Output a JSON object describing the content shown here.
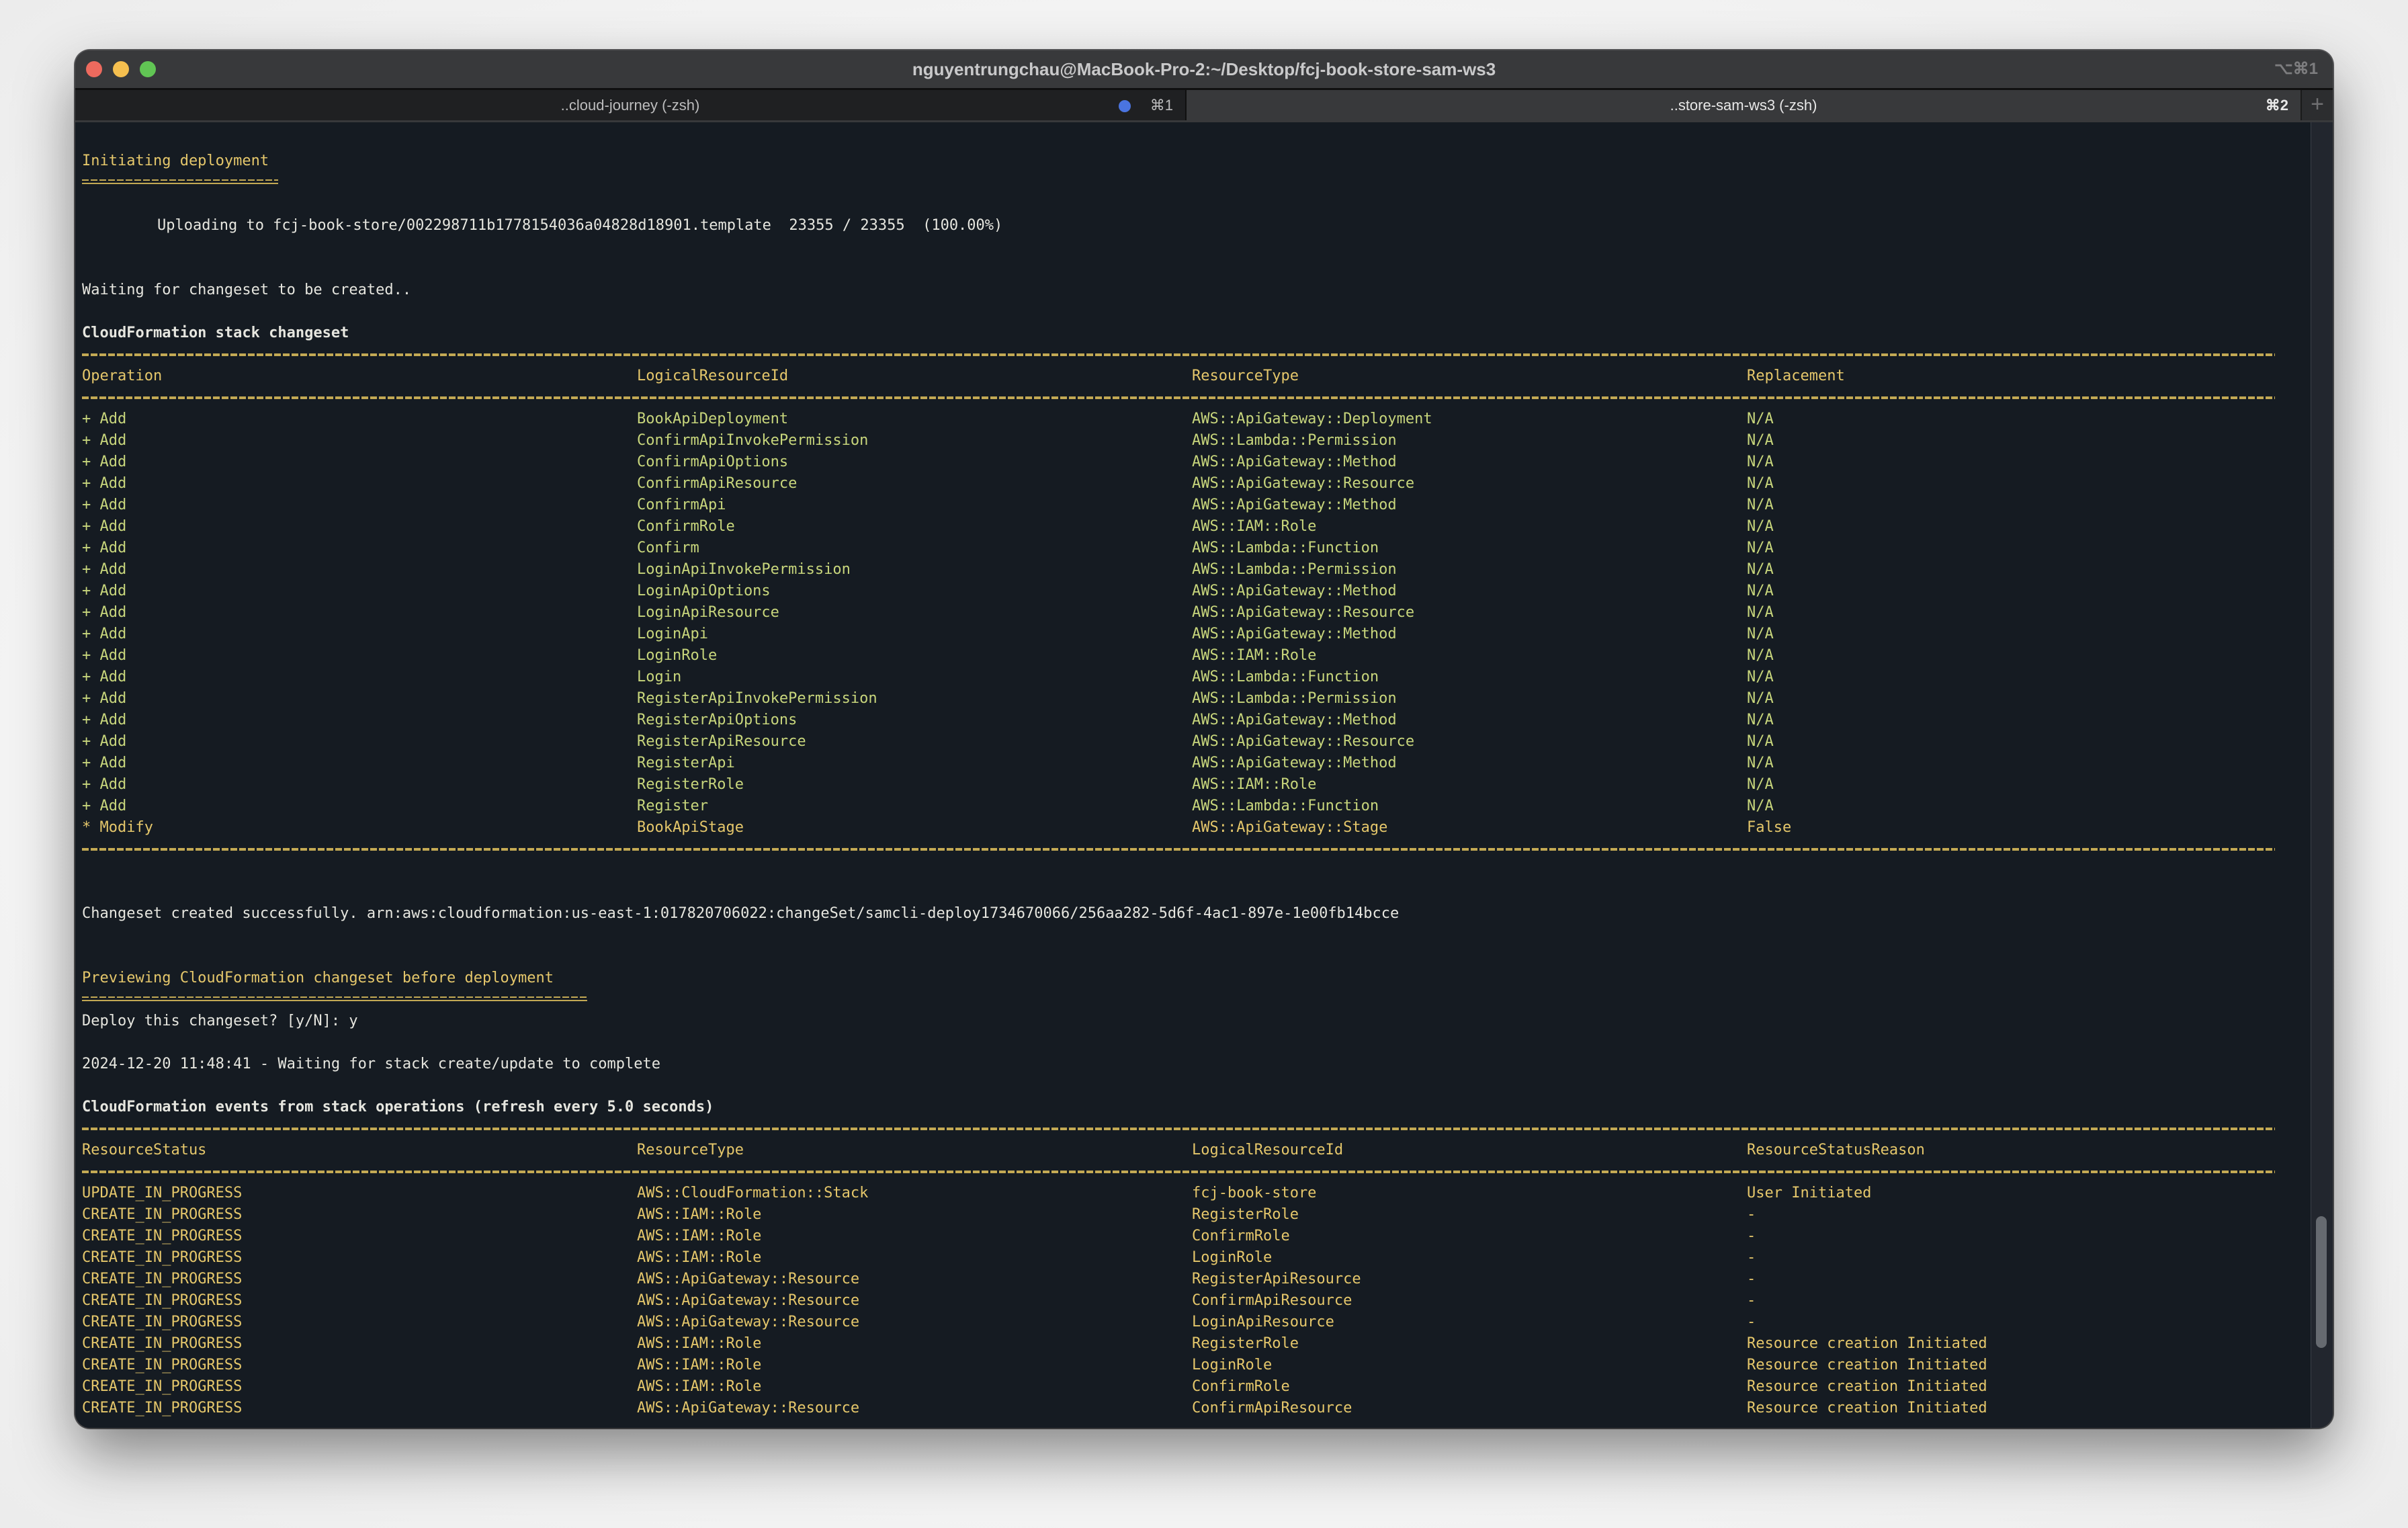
{
  "window": {
    "title": "nguyentrungchau@MacBook-Pro-2:~/Desktop/fcj-book-store-sam-ws3",
    "title_shortcut": "⌥⌘1",
    "traffic_lights": [
      "close",
      "minimize",
      "maximize"
    ],
    "colors": {
      "close": "#ed6a5e",
      "minimize": "#f5bf4f",
      "maximize": "#61c554"
    }
  },
  "tabs": [
    {
      "label": "..cloud-journey (-zsh)",
      "shortcut": "⌘1",
      "active": false,
      "has_activity_dot": true
    },
    {
      "label": "..store-sam-ws3 (-zsh)",
      "shortcut": "⌘2",
      "active": true,
      "has_activity_dot": false
    }
  ],
  "new_tab_label": "+",
  "terminal": {
    "initiating": "Initiating deployment",
    "initiating_rule": "=====================",
    "uploading": "Uploading to fcj-book-store/002298711b1778154036a04828d18901.template  23355 / 23355  (100.00%)",
    "waiting_changeset": "Waiting for changeset to be created..",
    "changeset_title": "CloudFormation stack changeset",
    "changeset_headers": [
      "Operation",
      "LogicalResourceId",
      "ResourceType",
      "Replacement"
    ],
    "changeset_rows": [
      [
        "+ Add",
        "BookApiDeployment",
        "AWS::ApiGateway::Deployment",
        "N/A"
      ],
      [
        "+ Add",
        "ConfirmApiInvokePermission",
        "AWS::Lambda::Permission",
        "N/A"
      ],
      [
        "+ Add",
        "ConfirmApiOptions",
        "AWS::ApiGateway::Method",
        "N/A"
      ],
      [
        "+ Add",
        "ConfirmApiResource",
        "AWS::ApiGateway::Resource",
        "N/A"
      ],
      [
        "+ Add",
        "ConfirmApi",
        "AWS::ApiGateway::Method",
        "N/A"
      ],
      [
        "+ Add",
        "ConfirmRole",
        "AWS::IAM::Role",
        "N/A"
      ],
      [
        "+ Add",
        "Confirm",
        "AWS::Lambda::Function",
        "N/A"
      ],
      [
        "+ Add",
        "LoginApiInvokePermission",
        "AWS::Lambda::Permission",
        "N/A"
      ],
      [
        "+ Add",
        "LoginApiOptions",
        "AWS::ApiGateway::Method",
        "N/A"
      ],
      [
        "+ Add",
        "LoginApiResource",
        "AWS::ApiGateway::Resource",
        "N/A"
      ],
      [
        "+ Add",
        "LoginApi",
        "AWS::ApiGateway::Method",
        "N/A"
      ],
      [
        "+ Add",
        "LoginRole",
        "AWS::IAM::Role",
        "N/A"
      ],
      [
        "+ Add",
        "Login",
        "AWS::Lambda::Function",
        "N/A"
      ],
      [
        "+ Add",
        "RegisterApiInvokePermission",
        "AWS::Lambda::Permission",
        "N/A"
      ],
      [
        "+ Add",
        "RegisterApiOptions",
        "AWS::ApiGateway::Method",
        "N/A"
      ],
      [
        "+ Add",
        "RegisterApiResource",
        "AWS::ApiGateway::Resource",
        "N/A"
      ],
      [
        "+ Add",
        "RegisterApi",
        "AWS::ApiGateway::Method",
        "N/A"
      ],
      [
        "+ Add",
        "RegisterRole",
        "AWS::IAM::Role",
        "N/A"
      ],
      [
        "+ Add",
        "Register",
        "AWS::Lambda::Function",
        "N/A"
      ],
      [
        "* Modify",
        "BookApiStage",
        "AWS::ApiGateway::Stage",
        "False"
      ]
    ],
    "changeset_created": "Changeset created successfully. arn:aws:cloudformation:us-east-1:017820706022:changeSet/samcli-deploy1734670066/256aa282-5d6f-4ac1-897e-1e00fb14bcce",
    "previewing": "Previewing CloudFormation changeset before deployment",
    "previewing_rule": "======================================================",
    "deploy_prompt": "Deploy this changeset? [y/N]: y",
    "waiting_stack": "2024-12-20 11:48:41 - Waiting for stack create/update to complete",
    "events_title": "CloudFormation events from stack operations (refresh every 5.0 seconds)",
    "events_headers": [
      "ResourceStatus",
      "ResourceType",
      "LogicalResourceId",
      "ResourceStatusReason"
    ],
    "events_rows": [
      [
        "UPDATE_IN_PROGRESS",
        "AWS::CloudFormation::Stack",
        "fcj-book-store",
        "User Initiated"
      ],
      [
        "CREATE_IN_PROGRESS",
        "AWS::IAM::Role",
        "RegisterRole",
        "-"
      ],
      [
        "CREATE_IN_PROGRESS",
        "AWS::IAM::Role",
        "ConfirmRole",
        "-"
      ],
      [
        "CREATE_IN_PROGRESS",
        "AWS::IAM::Role",
        "LoginRole",
        "-"
      ],
      [
        "CREATE_IN_PROGRESS",
        "AWS::ApiGateway::Resource",
        "RegisterApiResource",
        "-"
      ],
      [
        "CREATE_IN_PROGRESS",
        "AWS::ApiGateway::Resource",
        "ConfirmApiResource",
        "-"
      ],
      [
        "CREATE_IN_PROGRESS",
        "AWS::ApiGateway::Resource",
        "LoginApiResource",
        "-"
      ],
      [
        "CREATE_IN_PROGRESS",
        "AWS::IAM::Role",
        "RegisterRole",
        "Resource creation Initiated"
      ],
      [
        "CREATE_IN_PROGRESS",
        "AWS::IAM::Role",
        "LoginRole",
        "Resource creation Initiated"
      ],
      [
        "CREATE_IN_PROGRESS",
        "AWS::IAM::Role",
        "ConfirmRole",
        "Resource creation Initiated"
      ],
      [
        "CREATE_IN_PROGRESS",
        "AWS::ApiGateway::Resource",
        "ConfirmApiResource",
        "Resource creation Initiated"
      ]
    ],
    "colors": {
      "background": "#151b22",
      "header_yellow": "#e5c76b",
      "add_green": "#c8d67c",
      "plain_text": "#e6e6df"
    }
  }
}
